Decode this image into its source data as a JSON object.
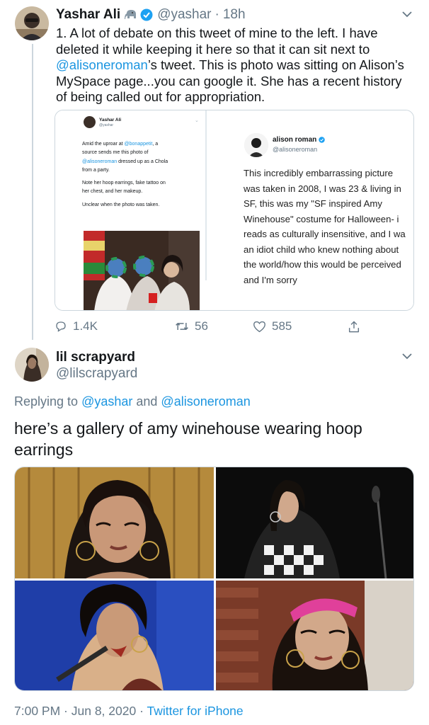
{
  "tweet1": {
    "name": "Yashar Ali",
    "handle": "@yashar",
    "separator": "·",
    "time": "18h",
    "text_before": "1. A lot of debate on this tweet of mine to the left. I have deleted it while keeping it here so that it can sit next to ",
    "mention": "@alisoneroman",
    "text_after": "’s tweet. This is photo was sitting on Alison’s MySpace page...you can google it. She has a recent history of being called out for appropriation.",
    "replies": "1.4K",
    "retweets": "56",
    "likes": "585",
    "embedded_left": {
      "name": "Yashar Ali",
      "handle": "@yashar",
      "line1a": "Amid the uproar at ",
      "line1b": "@bonappetit",
      "line1c": ", a",
      "line2": "source sends me this photo of",
      "line3a": "@alisoneroman",
      "line3b": " dressed up as a Chola",
      "line4": "from a party.",
      "line5": "Note her hoop earrings, fake tattoo on",
      "line6": "her chest, and her makeup.",
      "line7": "Unclear when the photo was taken."
    },
    "embedded_right": {
      "name": "alison roman",
      "handle": "@alisoneroman",
      "lines": [
        "This incredibly embarrassing picture",
        "was taken in 2008, I was 23 & living in",
        "SF, this was my \"SF inspired Amy",
        "Winehouse\" costume for Halloween- i",
        "reads as culturally insensitive, and I wa",
        "an idiot child who knew nothing about",
        "the world/how this would be perceived",
        "and I'm sorry"
      ]
    }
  },
  "tweet2": {
    "name": "lil scrapyard",
    "handle": "@lilscrapyard",
    "replying_prefix": "Replying to ",
    "replying_to_1": "@yashar",
    "replying_and": " and ",
    "replying_to_2": "@alisoneroman",
    "text": "here’s a gallery of amy winehouse wearing hoop earrings",
    "footer_time": "7:00 PM",
    "footer_sep": " · ",
    "footer_date": "Jun 8, 2020",
    "footer_sep2": " · ",
    "footer_source": "Twitter for iPhone"
  },
  "colors": {
    "accent": "#1b95e0",
    "secondary": "#657786",
    "verified": "#1da1f2",
    "border": "#ccd6dd"
  },
  "icons": [
    "elephant-emoji-icon",
    "verified-badge-icon",
    "chevron-down-icon",
    "reply-icon",
    "retweet-icon",
    "like-icon",
    "share-icon"
  ]
}
